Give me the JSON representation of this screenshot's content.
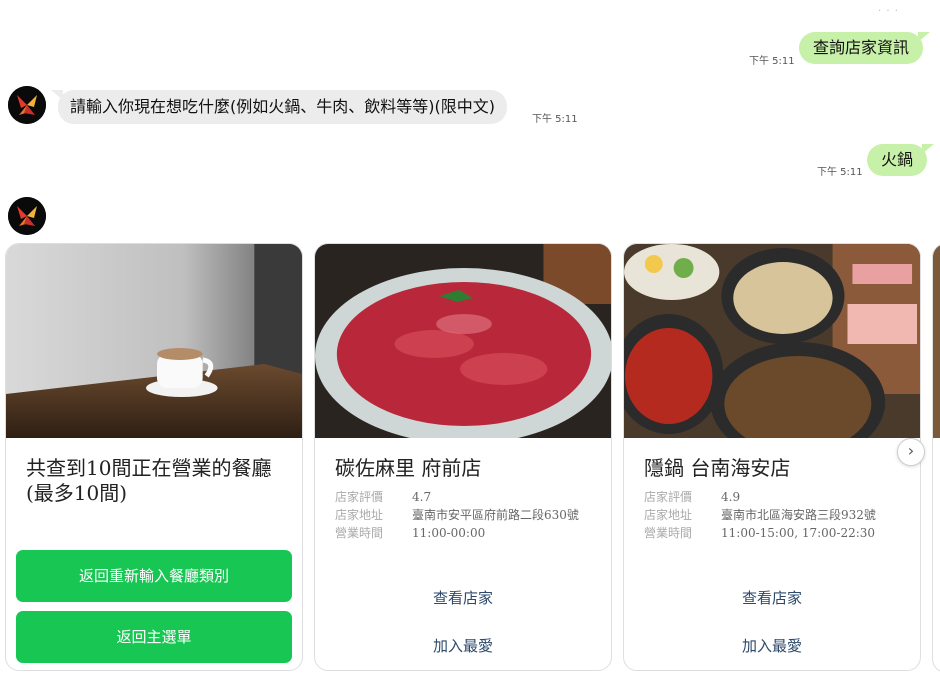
{
  "chat": {
    "msg1": {
      "text": "查詢店家資訊",
      "time": "下午 5:11"
    },
    "msg2": {
      "text": "請輸入你現在想吃什麼(例如火鍋、牛肉、飲料等等)(限中文)",
      "time": "下午 5:11"
    },
    "msg3": {
      "text": "火鍋",
      "time": "下午 5:11"
    }
  },
  "carousel": {
    "summary_card": {
      "title": "共查到10間正在營業的餐廳(最多10間)",
      "button1": "返回重新輸入餐廳類別",
      "button2": "返回主選單",
      "image_icon": "coffee-cup-photo"
    },
    "labels": {
      "rating": "店家評價",
      "address": "店家地址",
      "hours": "營業時間"
    },
    "restaurants": [
      {
        "name": "碳佐麻里 府前店",
        "rating": "4.7",
        "address": "臺南市安平區府前路二段630號",
        "hours": "11:00-00:00",
        "view_label": "查看店家",
        "fav_label": "加入最愛",
        "image_icon": "marbled-beef-photo"
      },
      {
        "name": "隱鍋 台南海安店",
        "rating": "4.9",
        "address": "臺南市北區海安路三段932號",
        "hours": "11:00-15:00, 17:00-22:30",
        "view_label": "查看店家",
        "fav_label": "加入最愛",
        "image_icon": "hotpot-photo"
      }
    ]
  },
  "colors": {
    "user_bubble": "#c7f0a8",
    "bot_bubble": "#ececec",
    "green_button": "#17c653",
    "link": "#2c4a6b"
  }
}
